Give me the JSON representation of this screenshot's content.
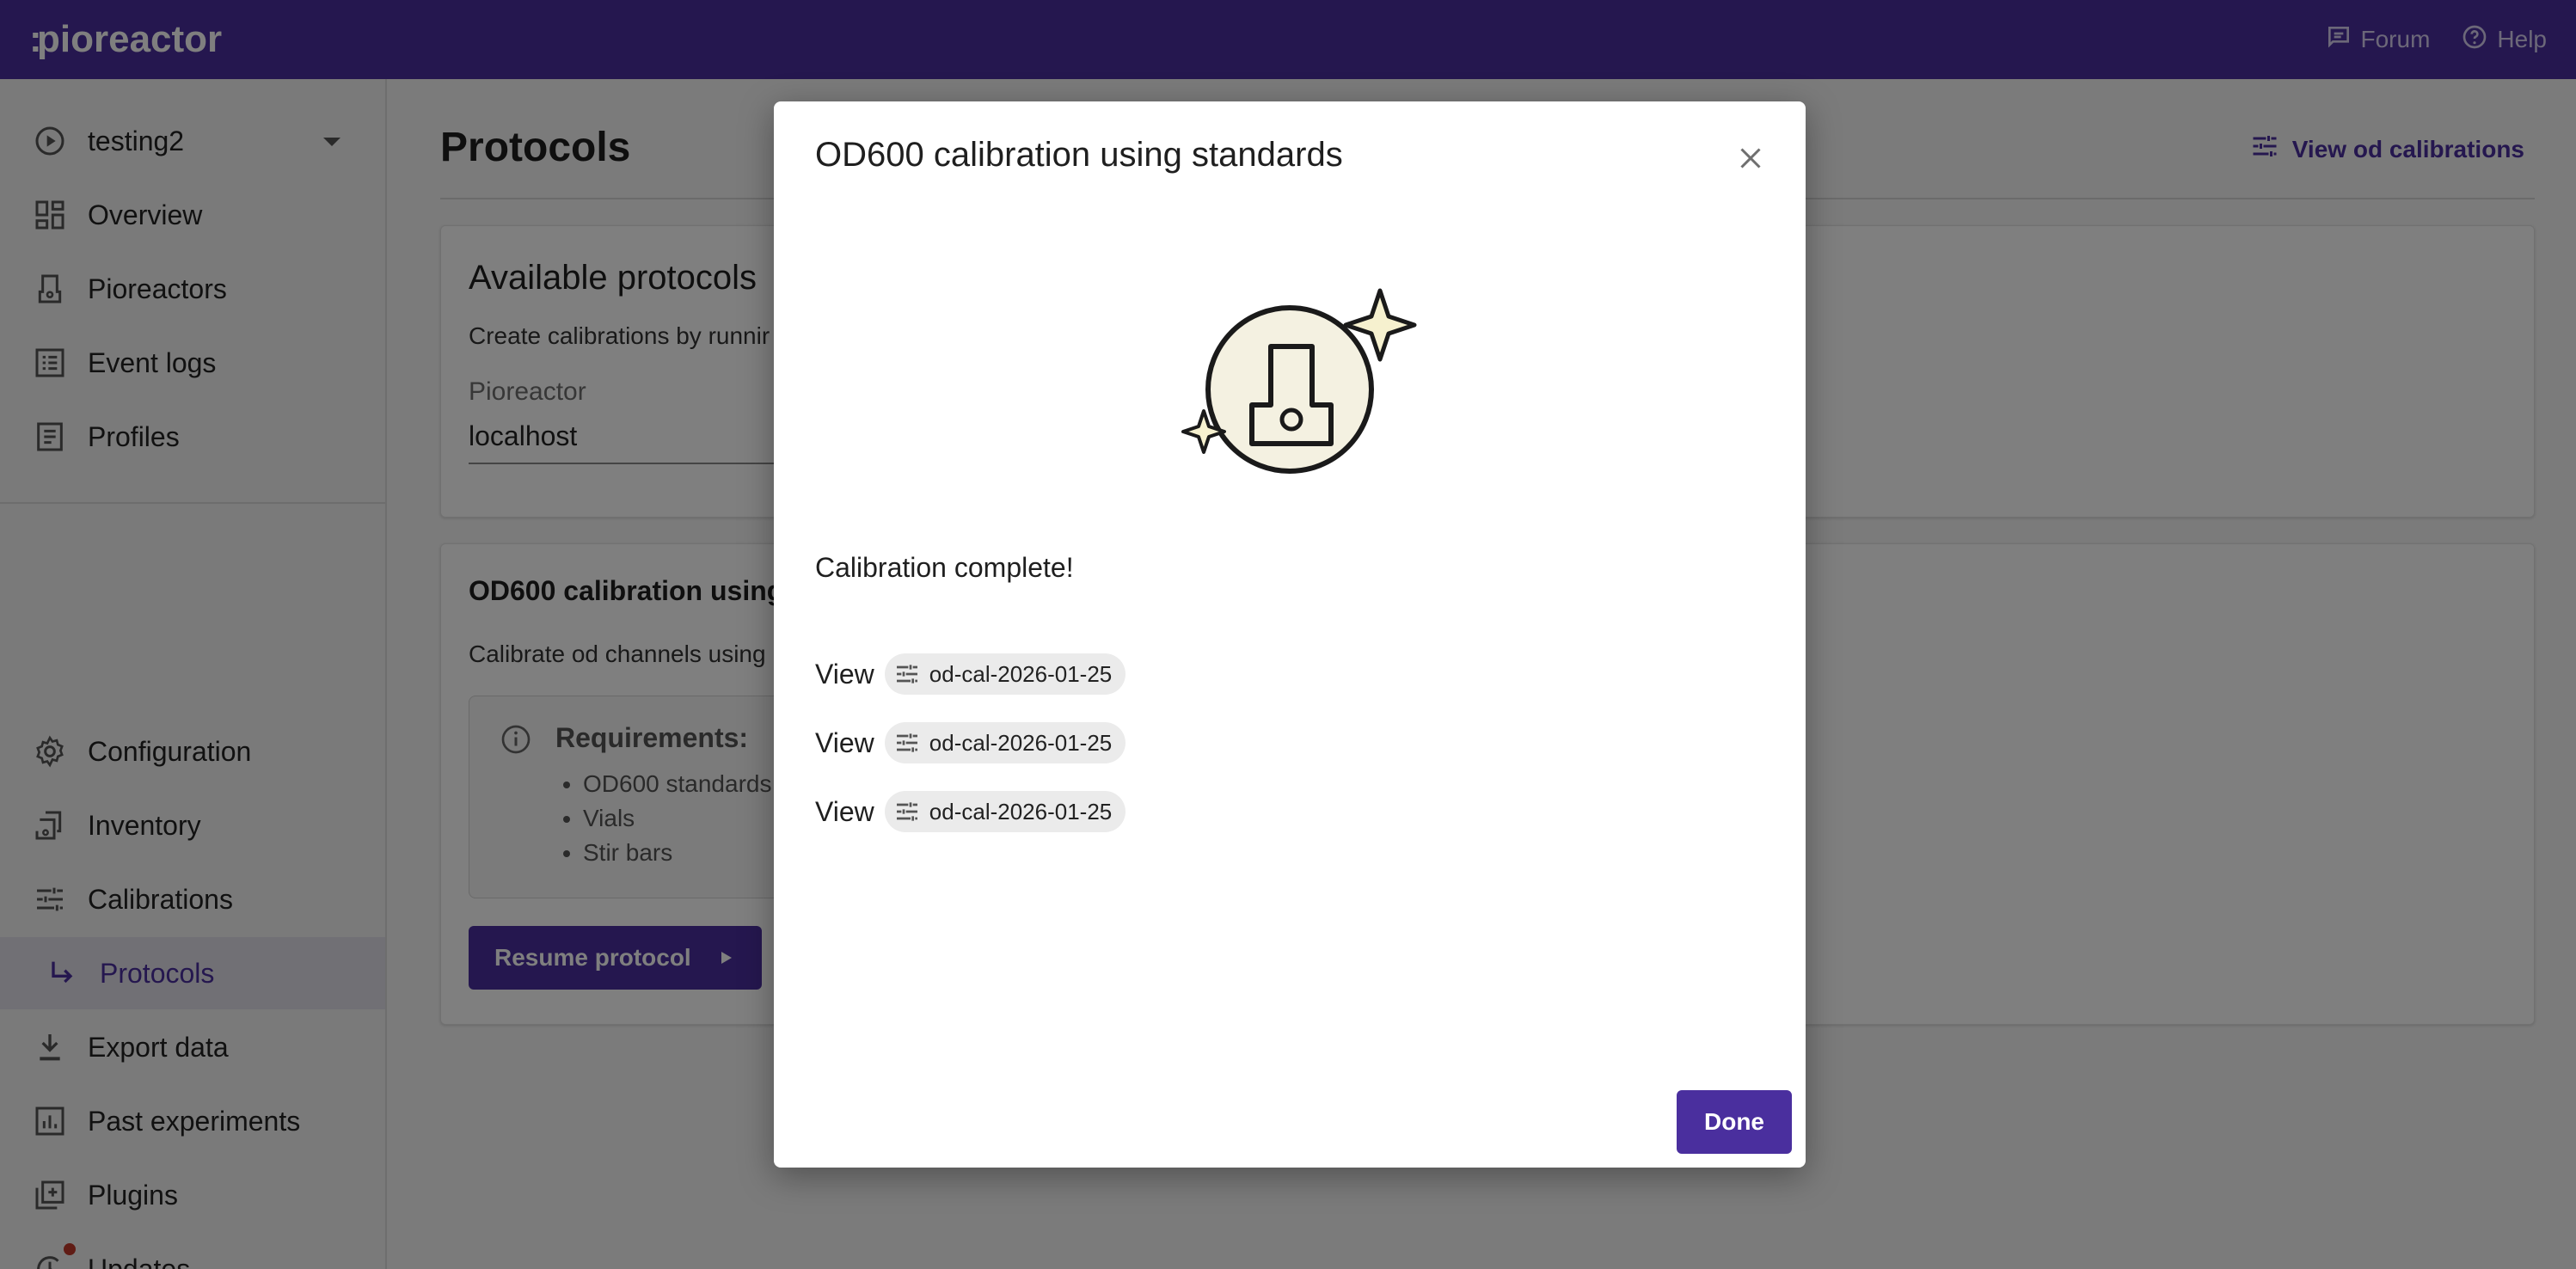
{
  "header": {
    "logo": "pioreactor",
    "links": [
      {
        "label": "Forum",
        "icon": "forum-icon"
      },
      {
        "label": "Help",
        "icon": "help-icon"
      }
    ]
  },
  "sidebar": {
    "experiment": "testing2",
    "top_items": [
      {
        "label": "Overview",
        "icon": "overview-icon"
      },
      {
        "label": "Pioreactors",
        "icon": "pioreactor-icon"
      },
      {
        "label": "Event logs",
        "icon": "event-logs-icon"
      },
      {
        "label": "Profiles",
        "icon": "profiles-icon"
      }
    ],
    "bottom_items": [
      {
        "label": "Configuration",
        "icon": "gear-icon"
      },
      {
        "label": "Inventory",
        "icon": "inventory-icon"
      },
      {
        "label": "Calibrations",
        "icon": "calibrations-icon"
      },
      {
        "label": "Protocols",
        "icon": "subdirectory-arrow-icon",
        "active": true
      },
      {
        "label": "Export data",
        "icon": "download-icon"
      },
      {
        "label": "Past experiments",
        "icon": "chart-icon"
      },
      {
        "label": "Plugins",
        "icon": "plugins-icon"
      },
      {
        "label": "Updates",
        "icon": "updates-icon"
      }
    ]
  },
  "main": {
    "title": "Protocols",
    "view_calibrations": "View od calibrations",
    "available": {
      "title": "Available protocols",
      "subtitle": "Create calibrations by runnir",
      "field_label": "Pioreactor",
      "field_value": "localhost"
    },
    "protocol_card": {
      "title": "OD600 calibration using",
      "subtitle": "Calibrate od channels using",
      "requirements_title": "Requirements:",
      "requirements": [
        "OD600 standards",
        "Vials",
        "Stir bars"
      ],
      "resume_label": "Resume protocol"
    }
  },
  "dialog": {
    "title": "OD600 calibration using standards",
    "message": "Calibration complete!",
    "view_label": "View",
    "calibrations": [
      "od-cal-2026-01-25",
      "od-cal-2026-01-25",
      "od-cal-2026-01-25"
    ],
    "done_label": "Done"
  },
  "colors": {
    "brand": "#4a2f9e",
    "illustration_fill": "#f4f1e1",
    "sparkle_fill": "#f6f1cf"
  }
}
